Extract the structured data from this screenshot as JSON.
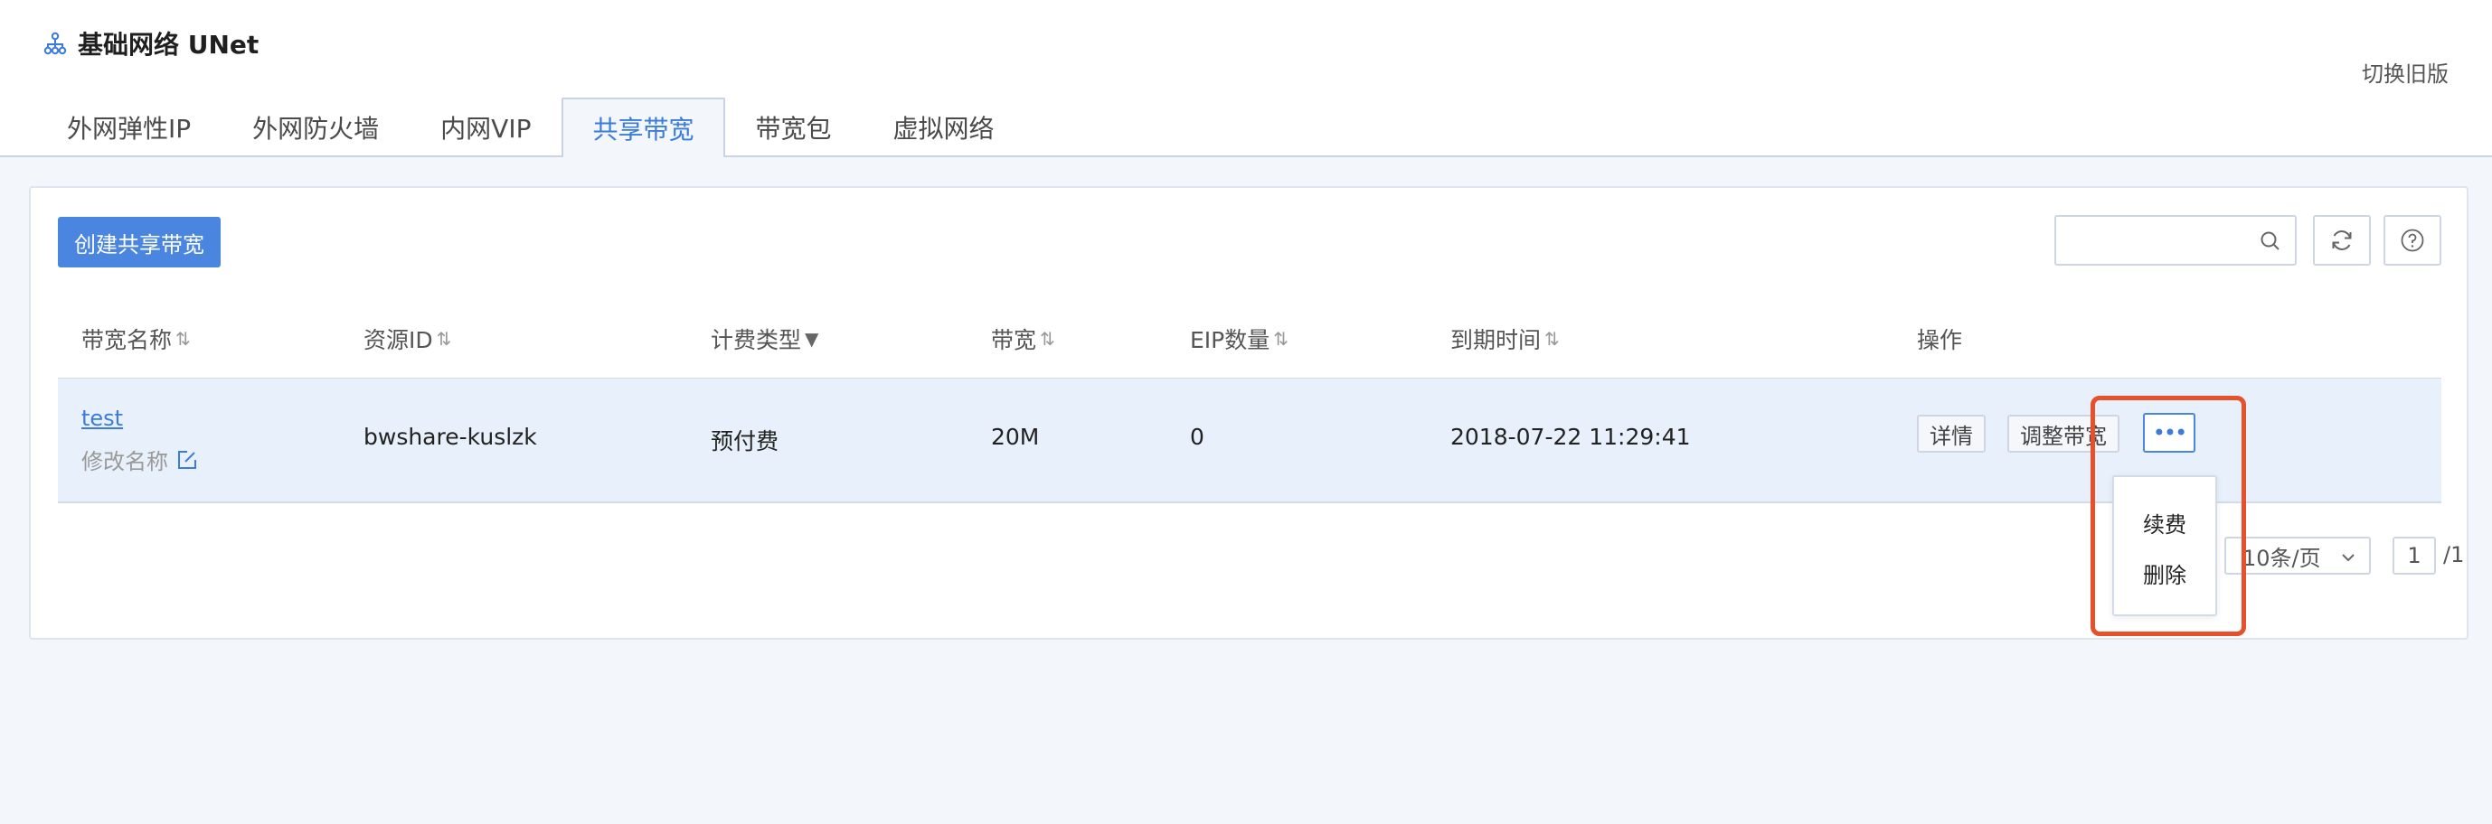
{
  "header": {
    "title": "基础网络 UNet",
    "title_icon": "network-topology-icon",
    "switch_old_label": "切换旧版"
  },
  "tabs": [
    {
      "label": "外网弹性IP"
    },
    {
      "label": "外网防火墙"
    },
    {
      "label": "内网VIP"
    },
    {
      "label": "共享带宽",
      "active": true
    },
    {
      "label": "带宽包"
    },
    {
      "label": "虚拟网络"
    }
  ],
  "toolbar": {
    "create_label": "创建共享带宽",
    "search_placeholder": "",
    "icons": [
      "search-icon",
      "refresh-icon",
      "help-icon"
    ]
  },
  "table": {
    "columns": [
      {
        "label": "带宽名称",
        "sortable": true
      },
      {
        "label": "资源ID",
        "sortable": true
      },
      {
        "label": "计费类型",
        "filterable": true
      },
      {
        "label": "带宽",
        "sortable": true
      },
      {
        "label": "EIP数量",
        "sortable": true
      },
      {
        "label": "到期时间",
        "sortable": true
      },
      {
        "label": "操作"
      }
    ],
    "sort_glyph": "⇅",
    "filter_glyph": "▼",
    "rows": [
      {
        "name": "test",
        "rename_label": "修改名称",
        "resource_id": "bwshare-kuslzk",
        "charge_type": "预付费",
        "bandwidth": "20M",
        "eip_count": "0",
        "expire_time": "2018-07-22 11:29:41",
        "actions": {
          "detail": "详情",
          "adjust": "调整带宽",
          "more": "•••"
        }
      }
    ]
  },
  "more_menu": {
    "items": [
      "续费",
      "删除"
    ]
  },
  "pagination": {
    "page_size": "10条/页",
    "current_page": "1",
    "total": "/1"
  },
  "colors": {
    "accent": "#4a86e0",
    "highlight": "#e6502b"
  }
}
